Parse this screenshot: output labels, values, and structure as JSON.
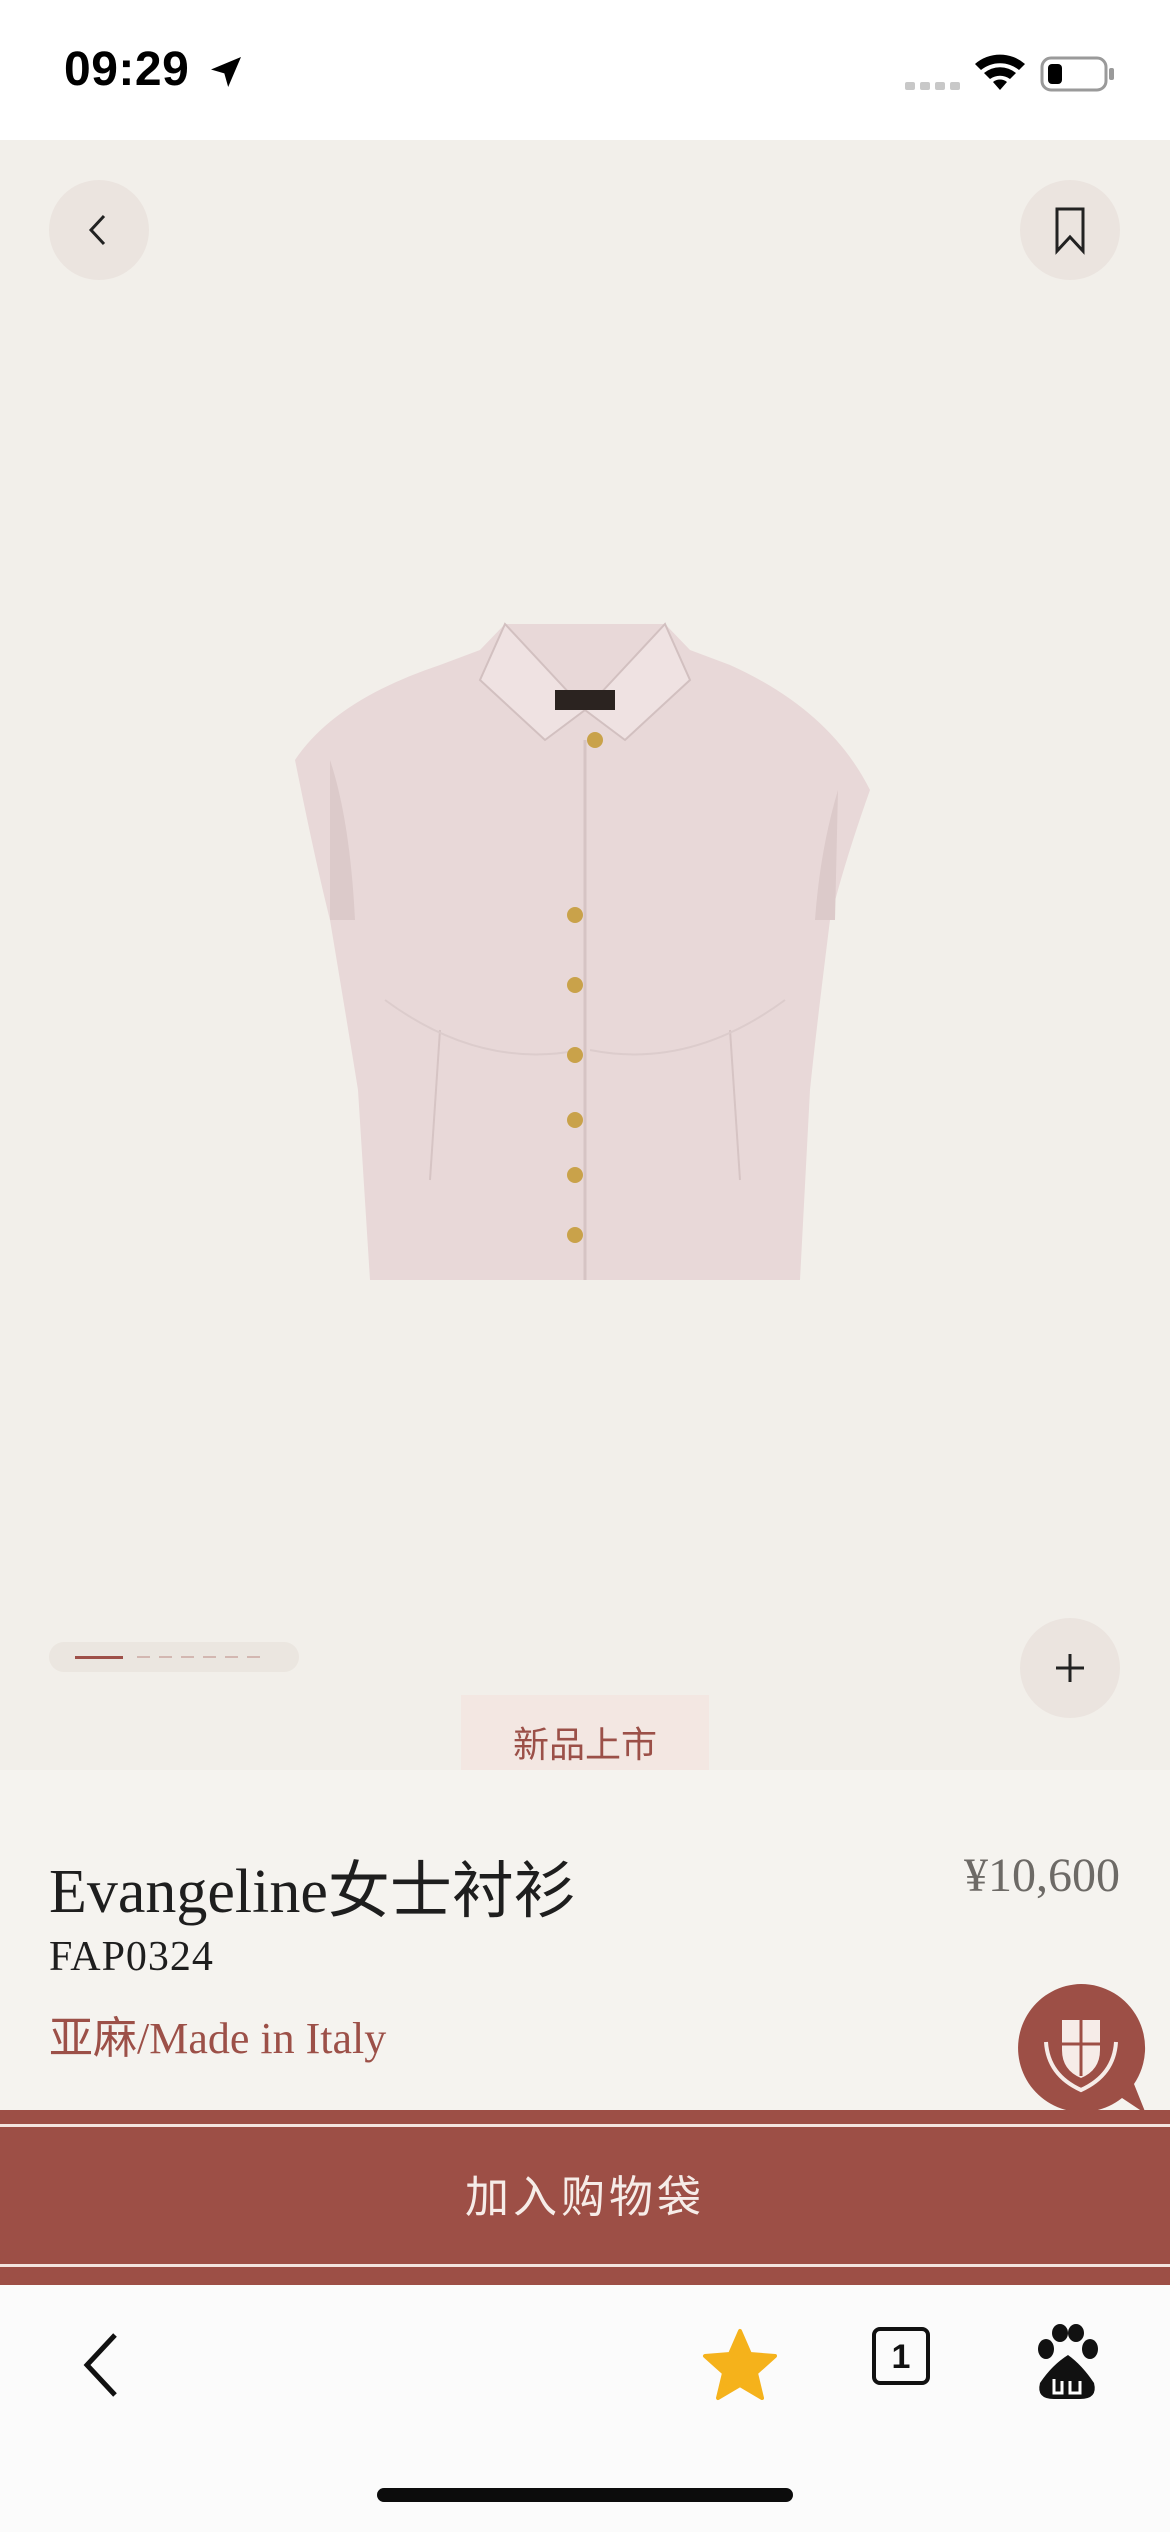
{
  "status_bar": {
    "time": "09:29"
  },
  "product": {
    "title": "Evangeline女士衬衫",
    "price": "¥10,600",
    "sku": "FAP0324",
    "material": "亚麻/Made in Italy",
    "tag": "新品上市",
    "image_count": 7,
    "current_image": 1
  },
  "actions": {
    "add_to_bag": "加入购物袋"
  },
  "browser_toolbar": {
    "tab_count": "1"
  },
  "colors": {
    "brand": "#9d4f46",
    "hero_bg": "#f2efea",
    "info_bg": "#f5f3ef",
    "star": "#f5b21b"
  },
  "icons": [
    "back-icon",
    "bookmark-icon",
    "plus-icon",
    "chat-crest-icon",
    "star-icon",
    "baidu-icon"
  ]
}
